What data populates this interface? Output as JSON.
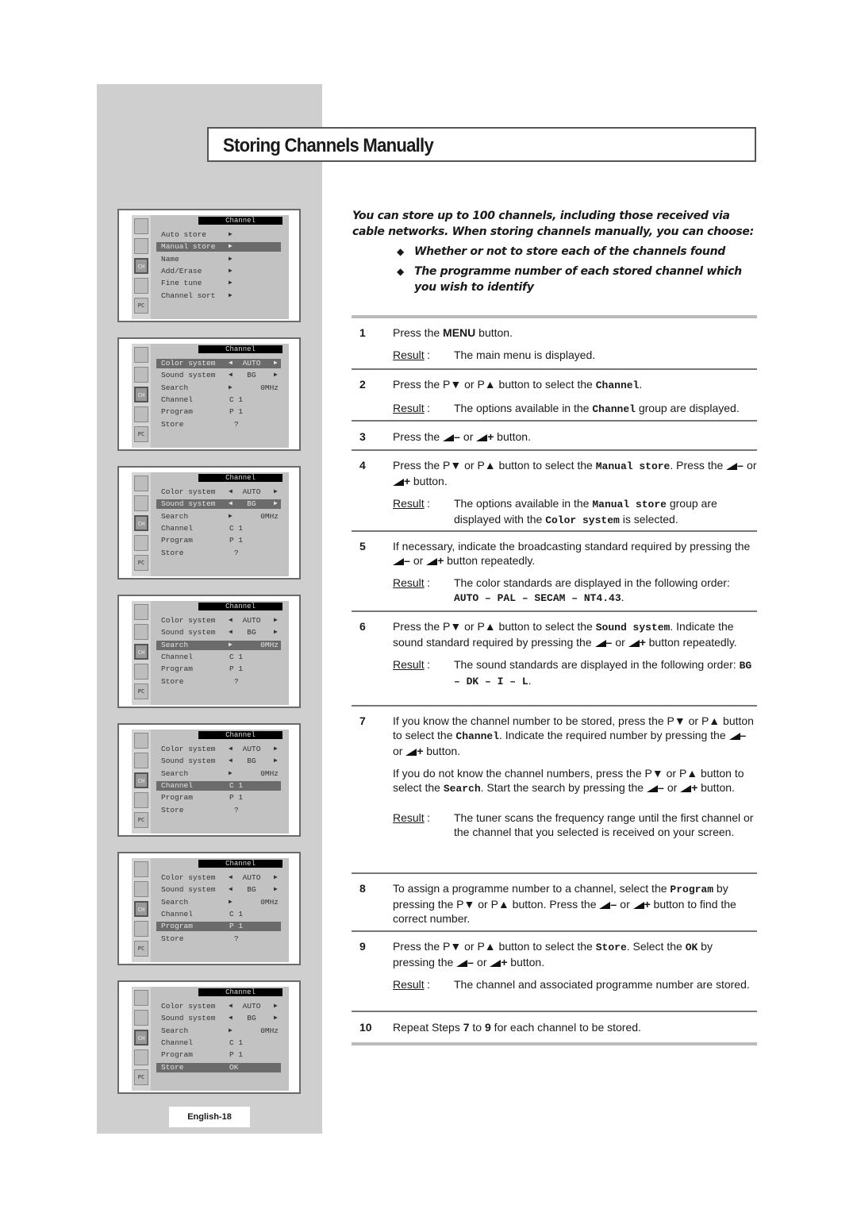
{
  "page": {
    "title": "Storing Channels Manually",
    "page_label": "English-18"
  },
  "intro": {
    "text": "You can store up to 100 channels, including those received via cable networks. When storing channels manually, you can choose:",
    "bullets": [
      "Whether or not to store each of the channels found",
      "The programme number of each stored channel which you wish to identify"
    ],
    "bullet_icon": "diamond-icon"
  },
  "osd": {
    "header": "Channel",
    "side_icons": [
      "picture-icon",
      "sound-icon",
      "channel-icon",
      "setup-hand-icon",
      "pc-icon"
    ],
    "side_icon_labels": [
      "",
      "",
      "CH",
      "",
      "PC"
    ],
    "menu1": {
      "items": [
        "Auto store",
        "Manual store",
        "Name",
        "Add/Erase",
        "Fine tune",
        "Channel sort"
      ],
      "selected": "Manual store"
    },
    "manual": {
      "color_system": {
        "label": "Color system",
        "value": "AUTO"
      },
      "sound_system": {
        "label": "Sound system",
        "value": "BG"
      },
      "search": {
        "label": "Search",
        "value": "0MHz"
      },
      "channel": {
        "label": "Channel",
        "value": "C 1"
      },
      "program": {
        "label": "Program",
        "value": "P 1"
      },
      "store": {
        "label": "Store",
        "value": "?",
        "value_ok": "OK"
      }
    },
    "screens_selected": [
      "Manual store",
      "Color system",
      "Sound system",
      "Search",
      "Channel",
      "Program",
      "Store"
    ]
  },
  "steps": [
    {
      "num": "1",
      "text": [
        "Press the ",
        {
          "b": "MENU"
        },
        " button."
      ],
      "result": "The main menu is displayed."
    },
    {
      "num": "2",
      "text": [
        "Press the P▼ or P▲ button to select the ",
        {
          "m": "Channel"
        },
        "."
      ],
      "result": [
        "The options available in the ",
        {
          "m": "Channel"
        },
        " group are displayed."
      ]
    },
    {
      "num": "3",
      "text": [
        "Press the ",
        {
          "v": "-"
        },
        " or ",
        {
          "v": "+"
        },
        " button."
      ]
    },
    {
      "num": "4",
      "text": [
        "Press the P▼ or P▲ button to select the ",
        {
          "m": "Manual store"
        },
        ". Press the ",
        {
          "v": "-"
        },
        " or ",
        {
          "v": "+"
        },
        " button."
      ],
      "result": [
        "The options available in the ",
        {
          "m": "Manual store"
        },
        " group are displayed with the ",
        {
          "m": "Color system"
        },
        " is selected."
      ]
    },
    {
      "num": "5",
      "text": [
        "If necessary, indicate the broadcasting standard required by pressing the ",
        {
          "v": "-"
        },
        " or ",
        {
          "v": "+"
        },
        " button repeatedly."
      ],
      "result": [
        "The color standards are displayed in the following order: ",
        {
          "m": "AUTO – PAL – SECAM – NT4.43"
        },
        "."
      ]
    },
    {
      "num": "6",
      "text": [
        "Press the P▼ or P▲ button to select the ",
        {
          "m": "Sound system"
        },
        ". Indicate the sound standard required by pressing the ",
        {
          "v": "-"
        },
        " or ",
        {
          "v": "+"
        },
        " button repeatedly."
      ],
      "result": [
        "The sound standards are displayed in the following order: ",
        {
          "m": "BG – DK – I – L"
        },
        "."
      ]
    },
    {
      "num": "7",
      "text": [
        "If you know the channel number to be stored, press the P▼ or P▲ button to select the ",
        {
          "m": "Channel"
        },
        ". Indicate the required number by pressing the ",
        {
          "v": "-"
        },
        " or ",
        {
          "v": "+"
        },
        " button."
      ],
      "text2": [
        "If you do not know the channel numbers, press the P▼ or P▲ button to select the ",
        {
          "m": "Search"
        },
        ". Start the search by pressing the ",
        {
          "v": "-"
        },
        " or ",
        {
          "v": "+"
        },
        " button."
      ],
      "result": "The tuner scans the frequency range until the first channel or the channel that you selected is received on your screen."
    },
    {
      "num": "8",
      "text": [
        "To assign a programme number to a channel, select the ",
        {
          "m": "Program"
        },
        " by pressing the P▼ or P▲ button. Press the ",
        {
          "v": "-"
        },
        " or ",
        {
          "v": "+"
        },
        " button to find the correct number."
      ]
    },
    {
      "num": "9",
      "text": [
        "Press the P▼ or P▲ button to select the ",
        {
          "m": "Store"
        },
        ". Select the ",
        {
          "m": "OK"
        },
        " by pressing the ",
        {
          "v": "-"
        },
        " or ",
        {
          "v": "+"
        },
        " button."
      ],
      "result": "The channel and associated programme number are stored."
    },
    {
      "num": "10",
      "text": [
        "Repeat Steps ",
        {
          "b": "7"
        },
        " to ",
        {
          "b": "9"
        },
        " for each channel to be stored."
      ]
    }
  ],
  "result_label": "Result",
  "result_colon": ":"
}
